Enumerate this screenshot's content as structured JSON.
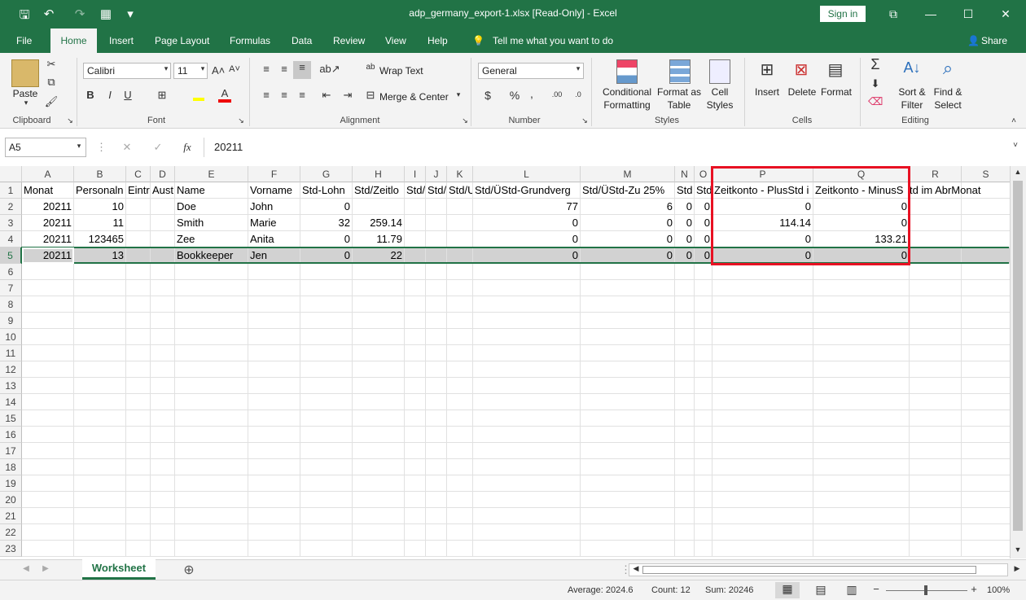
{
  "window": {
    "title": "adp_germany_export-1.xlsx  [Read-Only]  -  Excel",
    "signin": "Sign in"
  },
  "qat": {
    "save": "🖫",
    "undo": "↶",
    "redo": "↷",
    "touch": "▦",
    "more": "▾"
  },
  "tabs": [
    "File",
    "Home",
    "Insert",
    "Page Layout",
    "Formulas",
    "Data",
    "Review",
    "View",
    "Help"
  ],
  "tell_me": "Tell me what you want to do",
  "share": "Share",
  "ribbon": {
    "clipboard": {
      "name": "Clipboard",
      "paste": "Paste"
    },
    "font": {
      "name": "Font",
      "family": "Calibri",
      "size": "11",
      "bold": "B",
      "italic": "I",
      "underline": "U"
    },
    "alignment": {
      "name": "Alignment",
      "wrap": "Wrap Text",
      "merge": "Merge & Center"
    },
    "number": {
      "name": "Number",
      "format": "General",
      "currency": "$",
      "percent": "%",
      "comma": ","
    },
    "styles": {
      "name": "Styles",
      "conditional": "Conditional Formatting",
      "format_table": "Format as Table",
      "cell_styles": "Cell Styles"
    },
    "cells": {
      "name": "Cells",
      "insert": "Insert",
      "delete": "Delete",
      "format": "Format"
    },
    "editing": {
      "name": "Editing",
      "sort": "Sort & Filter",
      "find": "Find & Select"
    }
  },
  "formula_bar": {
    "name_box": "A5",
    "fx": "fx",
    "value": "20211"
  },
  "columns": [
    "A",
    "B",
    "C",
    "D",
    "E",
    "F",
    "G",
    "H",
    "I",
    "J",
    "K",
    "L",
    "M",
    "N",
    "O",
    "P",
    "Q",
    "R",
    "S"
  ],
  "rows": [
    [
      "Monat",
      "Personaln",
      "Eintr",
      "Aust",
      "Name",
      "Vorname",
      "Std-Lohn",
      "Std/Zeitlo",
      "Std/",
      "Std/",
      "Std/U",
      "Std/ÜStd-Grundverg",
      "Std/ÜStd-Zu 25%",
      "Std",
      "Std",
      "Zeitkonto - PlusStd i",
      "Zeitkonto - MinusS",
      "td im AbrMonat",
      ""
    ],
    [
      "20211",
      "10",
      "",
      "",
      "Doe",
      "John",
      "0",
      "",
      "",
      "",
      "",
      "77",
      "6",
      "0",
      "0",
      "0",
      "0",
      "",
      ""
    ],
    [
      "20211",
      "11",
      "",
      "",
      "Smith",
      "Marie",
      "32",
      "259.14",
      "",
      "",
      "",
      "0",
      "0",
      "0",
      "0",
      "114.14",
      "0",
      "",
      ""
    ],
    [
      "20211",
      "123465",
      "",
      "",
      "Zee",
      "Anita",
      "0",
      "11.79",
      "",
      "",
      "",
      "0",
      "0",
      "0",
      "0",
      "0",
      "133.21",
      "",
      ""
    ],
    [
      "20211",
      "13",
      "",
      "",
      "Bookkeeper",
      "Jen",
      "0",
      "22",
      "",
      "",
      "",
      "0",
      "0",
      "0",
      "0",
      "0",
      "0",
      "",
      ""
    ]
  ],
  "row_numbers": [
    "1",
    "2",
    "3",
    "4",
    "5",
    "6",
    "7",
    "8",
    "9",
    "10",
    "11",
    "12",
    "13",
    "14",
    "15",
    "16",
    "17",
    "18",
    "19",
    "20",
    "21",
    "22",
    "23"
  ],
  "sheet_tab": "Worksheet",
  "status": {
    "average": "Average: 2024.6",
    "count": "Count: 12",
    "sum": "Sum: 20246",
    "zoom": "100%"
  },
  "colors": {
    "brand": "#217346",
    "highlight": "#e81123"
  }
}
